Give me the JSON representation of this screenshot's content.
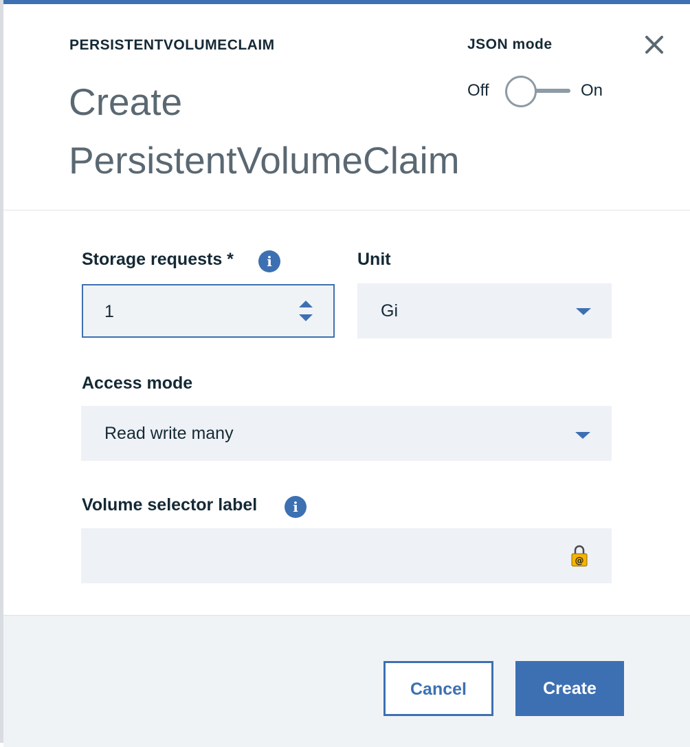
{
  "header": {
    "eyebrow": "PERSISTENTVOLUMECLAIM",
    "title": "Create PersistentVolumeClaim",
    "json_mode": {
      "label": "JSON mode",
      "off_label": "Off",
      "on_label": "On",
      "state": "off"
    },
    "close_icon": "close-icon"
  },
  "form": {
    "storage_requests": {
      "label": "Storage requests *",
      "value": "1",
      "info_icon": "info-icon"
    },
    "unit": {
      "label": "Unit",
      "selected": "Gi"
    },
    "access_mode": {
      "label": "Access mode",
      "selected": "Read write many"
    },
    "volume_selector_label": {
      "label": "Volume selector label",
      "value": "",
      "info_icon": "info-icon",
      "autofill_icon": "lock-icon"
    }
  },
  "footer": {
    "cancel_label": "Cancel",
    "create_label": "Create"
  },
  "colors": {
    "accent": "#3d70b2",
    "field_bg": "#eef1f6",
    "footer_bg": "#f0f3f6",
    "title_gray": "#5a6872",
    "text": "#152935"
  }
}
